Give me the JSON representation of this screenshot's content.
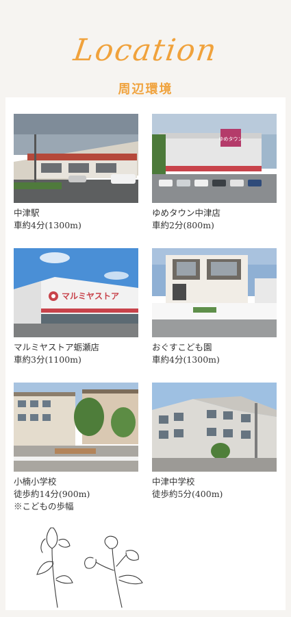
{
  "header": {
    "title": "Location",
    "subtitle": "周辺環境"
  },
  "places": [
    {
      "name": "中津駅",
      "time": "車約4分(1300m)",
      "note": "",
      "icon": "station-photo"
    },
    {
      "name": "ゆめタウン中津店",
      "time": "車約2分(800m)",
      "note": "",
      "icon": "shopping-mall-photo"
    },
    {
      "name": "マルミヤストア蛎瀬店",
      "time": "車約3分(1100m)",
      "note": "",
      "icon": "supermarket-photo"
    },
    {
      "name": "おぐすこども園",
      "time": "車約4分(1300m)",
      "note": "",
      "icon": "nursery-photo"
    },
    {
      "name": "小楠小学校",
      "time": "徒歩約14分(900m)",
      "note": "※こどもの歩幅",
      "icon": "elementary-school-photo"
    },
    {
      "name": "中津中学校",
      "time": "徒歩約5分(400m)",
      "note": "",
      "icon": "junior-high-school-photo"
    }
  ],
  "signs": {
    "mall": "ゆめタウン",
    "supermarket": "マルミヤストア"
  },
  "colors": {
    "accent": "#f0a23c",
    "text": "#333333",
    "background": "#f6f4f1",
    "card": "#ffffff"
  }
}
